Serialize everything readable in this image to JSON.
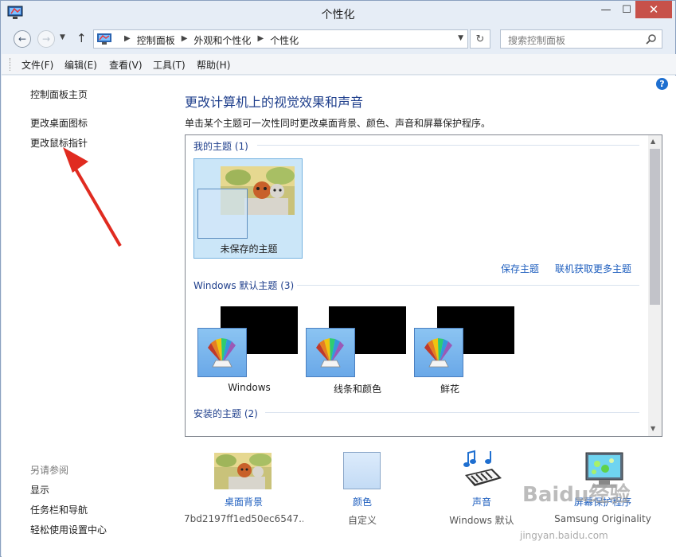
{
  "window": {
    "title": "个性化"
  },
  "address": {
    "crumbs": [
      "控制面板",
      "外观和个性化",
      "个性化"
    ],
    "search_placeholder": "搜索控制面板"
  },
  "menu": [
    "文件(F)",
    "编辑(E)",
    "查看(V)",
    "工具(T)",
    "帮助(H)"
  ],
  "sidebar": {
    "home": "控制面板主页",
    "links": [
      "更改桌面图标",
      "更改鼠标指针"
    ],
    "see_also_title": "另请参阅",
    "see_also": [
      "显示",
      "任务栏和导航",
      "轻松使用设置中心"
    ]
  },
  "main": {
    "title": "更改计算机上的视觉效果和声音",
    "description": "单击某个主题可一次性同时更改桌面背景、颜色、声音和屏幕保护程序。"
  },
  "themes": {
    "my_header": "我的主题 (1)",
    "unsaved_label": "未保存的主题",
    "save_link": "保存主题",
    "more_link": "联机获取更多主题",
    "default_header": "Windows 默认主题 (3)",
    "defaults": [
      "Windows",
      "线条和颜色",
      "鲜花"
    ],
    "installed_header": "安装的主题 (2)"
  },
  "bottom": [
    {
      "label": "桌面背景",
      "sub": "7bd2197ff1ed50ec6547..."
    },
    {
      "label": "颜色",
      "sub": "自定义"
    },
    {
      "label": "声音",
      "sub": "Windows 默认"
    },
    {
      "label": "屏幕保护程序",
      "sub": "Samsung Originality"
    }
  ],
  "watermark": {
    "text": "Baidu经验",
    "sub": "jingyan.baidu.com"
  },
  "colors": {
    "accent_link": "#1f5fbf",
    "title_blue": "#1f3f8c",
    "arrow_red": "#e02b20"
  }
}
